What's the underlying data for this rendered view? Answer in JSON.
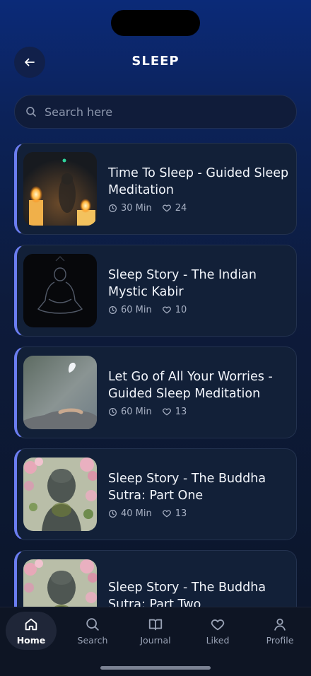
{
  "header": {
    "title": "SLEEP"
  },
  "search": {
    "placeholder": "Search here"
  },
  "sessions": [
    {
      "title": "Time To Sleep - Guided Sleep Meditation",
      "duration": "30 Min",
      "likes": "24",
      "thumb": "candles-icon"
    },
    {
      "title": "Sleep Story - The Indian Mystic Kabir",
      "duration": "60 Min",
      "likes": "10",
      "thumb": "meditating-silhouette-icon"
    },
    {
      "title": "Let Go of All Your Worries - Guided Sleep Meditation",
      "duration": "60 Min",
      "likes": "13",
      "thumb": "feather-hand-icon"
    },
    {
      "title": "Sleep Story - The Buddha Sutra: Part One",
      "duration": "40 Min",
      "likes": "13",
      "thumb": "buddha-statue-icon"
    },
    {
      "title": "Sleep Story - The Buddha Sutra: Part Two",
      "duration": "",
      "likes": "",
      "thumb": "buddha-statue-icon"
    }
  ],
  "tabs": [
    {
      "label": "Home",
      "icon": "home-icon",
      "active": true
    },
    {
      "label": "Search",
      "icon": "search-icon",
      "active": false
    },
    {
      "label": "Journal",
      "icon": "book-icon",
      "active": false
    },
    {
      "label": "Liked",
      "icon": "heart-icon",
      "active": false
    },
    {
      "label": "Profile",
      "icon": "user-icon",
      "active": false
    }
  ],
  "colors": {
    "accent": "#6b7df0",
    "card": "#122038",
    "background": "#0c1528"
  }
}
